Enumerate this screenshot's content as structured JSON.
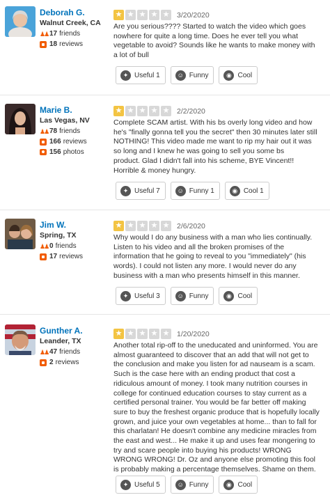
{
  "colors": {
    "accent": "#0073bb",
    "star": "#f3c443",
    "icon": "#f15c00"
  },
  "reviews": [
    {
      "name": "Deborah G.",
      "location": "Walnut Creek, CA",
      "friends": "17",
      "friends_label": "friends",
      "reviews": "18",
      "reviews_label": "reviews",
      "rating": 1,
      "date": "3/20/2020",
      "text": "Are you serious???? Started to watch the video which goes\nnowhere for quite a long time. Does he ever tell you what\nvegetable to avoid? Sounds like he wants to make money with\na lot of bull",
      "useful": "Useful 1",
      "funny": "Funny",
      "cool": "Cool"
    },
    {
      "name": "Marie B.",
      "location": "Las Vegas, NV",
      "friends": "78",
      "friends_label": "friends",
      "reviews": "166",
      "reviews_label": "reviews",
      "photos": "156",
      "photos_label": "photos",
      "rating": 1,
      "date": "2/2/2020",
      "text": "Complete SCAM artist. With his bs overly long video and how\nhe's \"finally gonna tell you the secret\" then 30 minutes later still\nNOTHING! This video made me want to rip my hair out it was\nso long and I knew he was going to sell you some bs\nproduct. Glad I didn't fall into his scheme, BYE Vincent!!\nHorrible & money hungry.",
      "useful": "Useful 7",
      "funny": "Funny 1",
      "cool": "Cool 1"
    },
    {
      "name": "Jim W.",
      "location": "Spring, TX",
      "friends": "0",
      "friends_label": "friends",
      "reviews": "17",
      "reviews_label": "reviews",
      "rating": 1,
      "date": "2/6/2020",
      "text": "Why would I do any business with  a man who lies continually.\nListen to his video and all the broken promises of the\ninformation that he going to reveal to you \"immediately\" (his\nwords). I could not listen any more. I would never do any\nbusiness with a man who presents himself in  this  manner.",
      "useful": "Useful 3",
      "funny": "Funny",
      "cool": "Cool"
    },
    {
      "name": "Gunther A.",
      "location": "Leander, TX",
      "friends": "47",
      "friends_label": "friends",
      "reviews": "2",
      "reviews_label": "reviews",
      "rating": 1,
      "date": "1/20/2020",
      "text": "Another total rip-off to the uneducated and uninformed.  You are\nalmost guaranteed to discover that an add that will not get to\nthe conclusion and make you listen for ad nauseam is a scam.\n Such is the case here with an ending product that cost a\nridiculous amount of money.  I took many nutrition courses in\ncollege for continued education courses to stay current as a\ncertified personal trainer.  You would be far better off making\nsure to buy the freshest organic produce that is hopefully locally\ngrown, and juice your own vegetables at home... than to fall for\nthis charlatan!  He doesn't combine any medicine miracles from\nthe east and west... He make it up and uses fear mongering to\ntry and scare people into buying his products!  WRONG\nWRONG WRONG!  Dr. Oz and anyone else promoting this fool\nis probably making a percentage themselves. Shame on them.",
      "useful": "Useful 5",
      "funny": "Funny",
      "cool": "Cool"
    }
  ]
}
